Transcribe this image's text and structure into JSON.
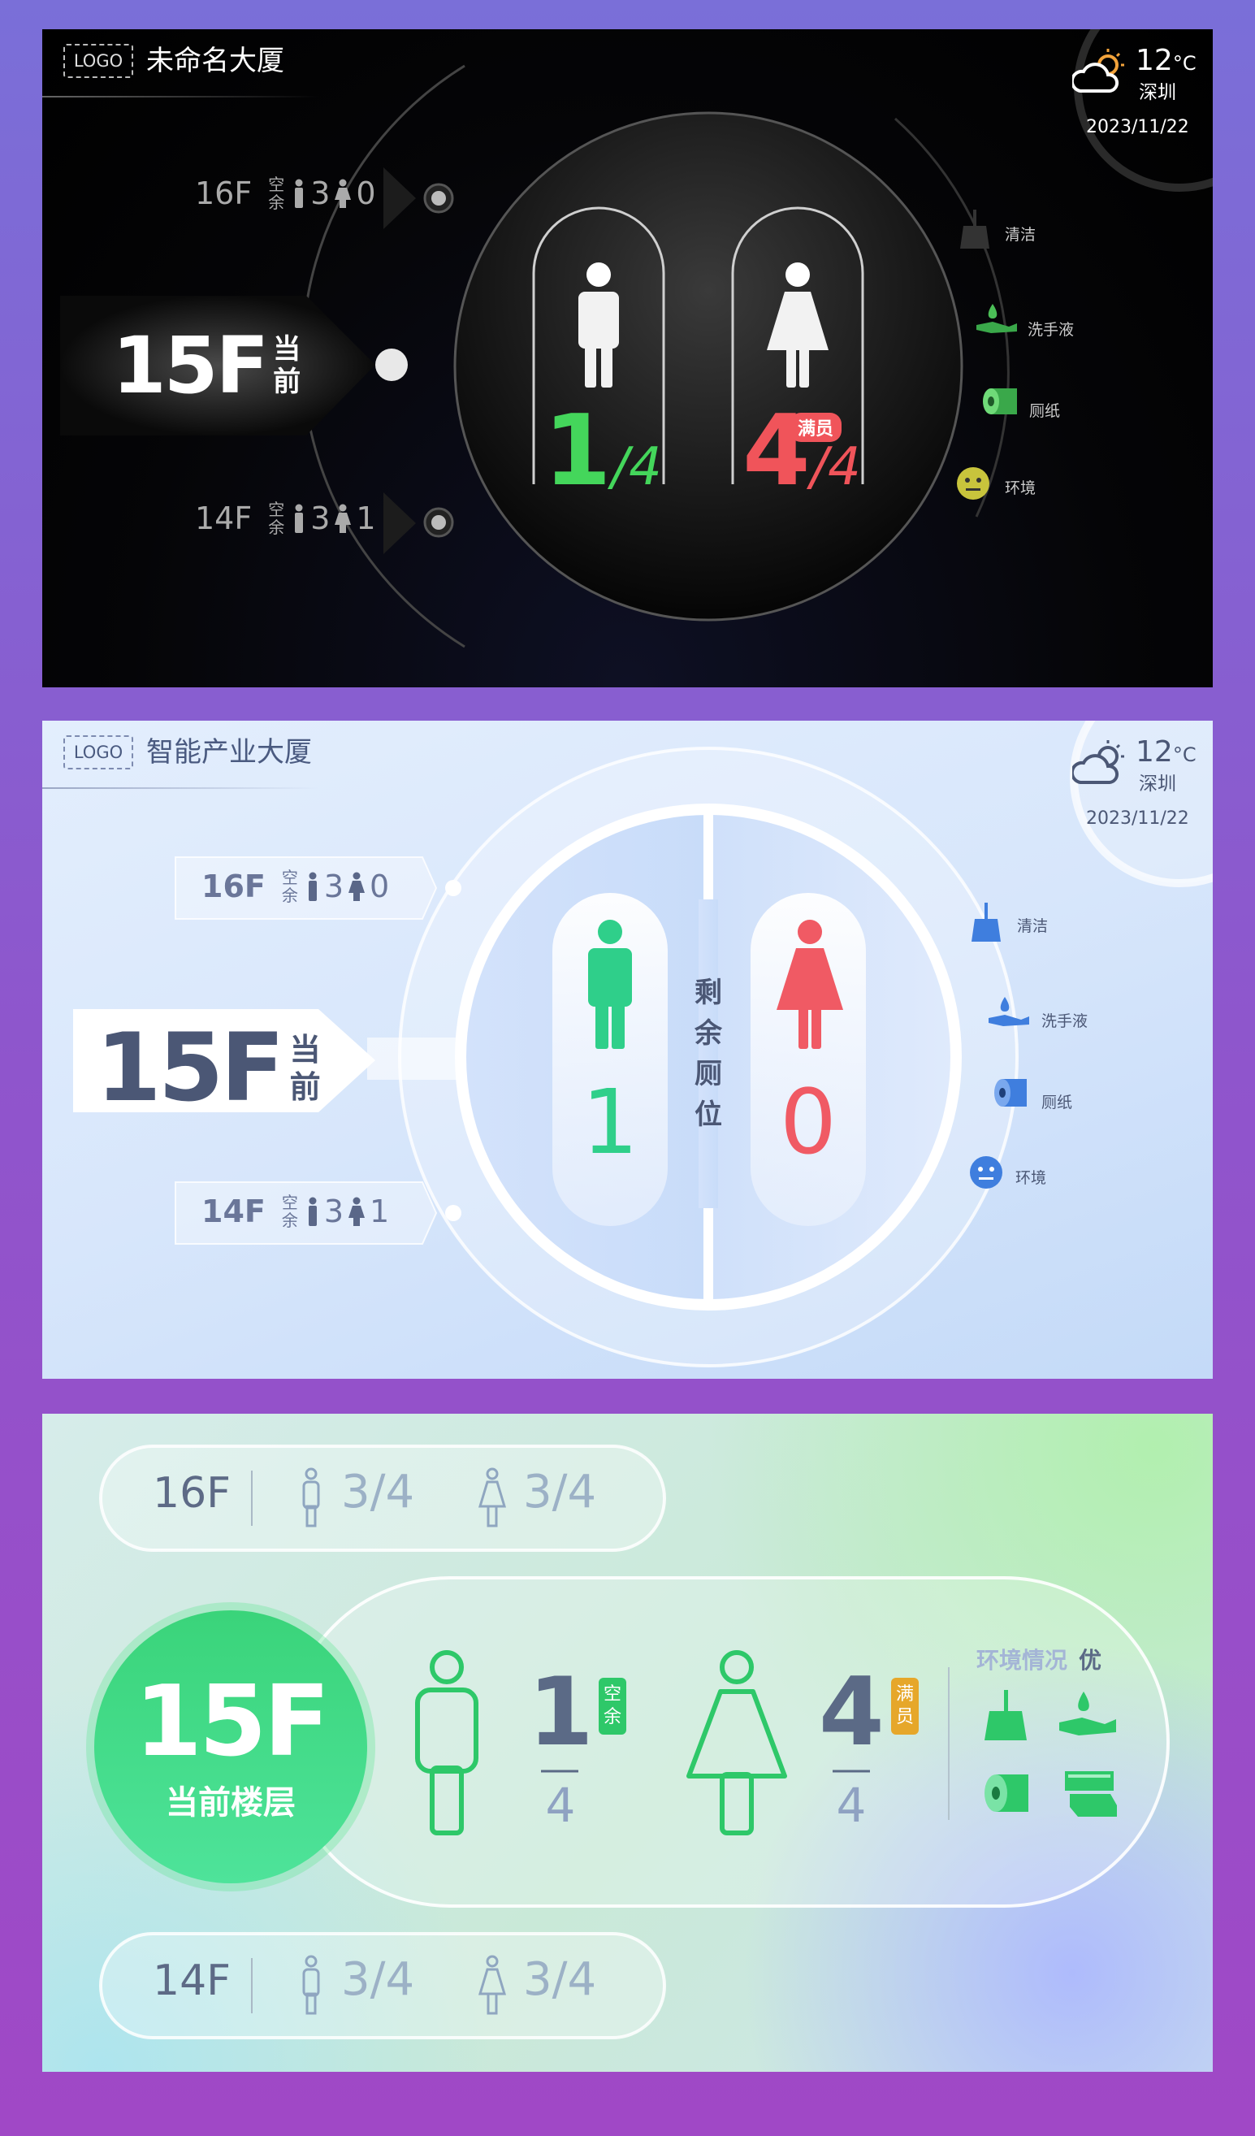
{
  "panel1": {
    "logo": "LOGO",
    "building": "未命名大厦",
    "weather": {
      "temp": "12",
      "unit": "°C",
      "city": "深圳",
      "date": "2023/11/22"
    },
    "upper_floor": {
      "floor": "16F",
      "vacant_top": "空",
      "vacant_bottom": "余",
      "male": "3",
      "female": "0"
    },
    "current_floor": {
      "floor": "15F",
      "label_top": "当",
      "label_bottom": "前"
    },
    "lower_floor": {
      "floor": "14F",
      "vacant_top": "空",
      "vacant_bottom": "余",
      "male": "3",
      "female": "1"
    },
    "male": {
      "available": "1",
      "total": "/4"
    },
    "female": {
      "available": "4",
      "total": "/4",
      "badge": "满员"
    },
    "amenities": [
      "清洁",
      "洗手液",
      "厕纸",
      "环境"
    ],
    "colors": {
      "green": "#44d65b",
      "red": "#f0545a"
    }
  },
  "panel2": {
    "logo": "LOGO",
    "building": "智能产业大厦",
    "weather": {
      "temp": "12",
      "unit": "°C",
      "city": "深圳",
      "date": "2023/11/22"
    },
    "upper_floor": {
      "floor": "16F",
      "vacant_top": "空",
      "vacant_bottom": "余",
      "male": "3",
      "female": "0"
    },
    "current_floor": {
      "floor": "15F",
      "label_top": "当",
      "label_bottom": "前"
    },
    "lower_floor": {
      "floor": "14F",
      "vacant_top": "空",
      "vacant_bottom": "余",
      "male": "3",
      "female": "1"
    },
    "remaining_label": [
      "剩",
      "余",
      "厕",
      "位"
    ],
    "male_remaining": "1",
    "female_remaining": "0",
    "amenities": [
      "清洁",
      "洗手液",
      "厕纸",
      "环境"
    ],
    "colors": {
      "green": "#2fcf8a",
      "red": "#f05a64"
    }
  },
  "panel3": {
    "upper_floor": {
      "floor": "16F",
      "male": "3/4",
      "female": "3/4"
    },
    "lower_floor": {
      "floor": "14F",
      "male": "3/4",
      "female": "3/4"
    },
    "current_floor": {
      "floor": "15F",
      "label": "当前楼层"
    },
    "male": {
      "available": "1",
      "total": "4",
      "tag_top": "空",
      "tag_bottom": "余"
    },
    "female": {
      "available": "4",
      "total": "4",
      "tag_top": "满",
      "tag_bottom": "员"
    },
    "environment": {
      "label": "环境情况",
      "rating": "优"
    },
    "colors": {
      "green": "#2ec869",
      "amber": "#e6a72a"
    }
  }
}
